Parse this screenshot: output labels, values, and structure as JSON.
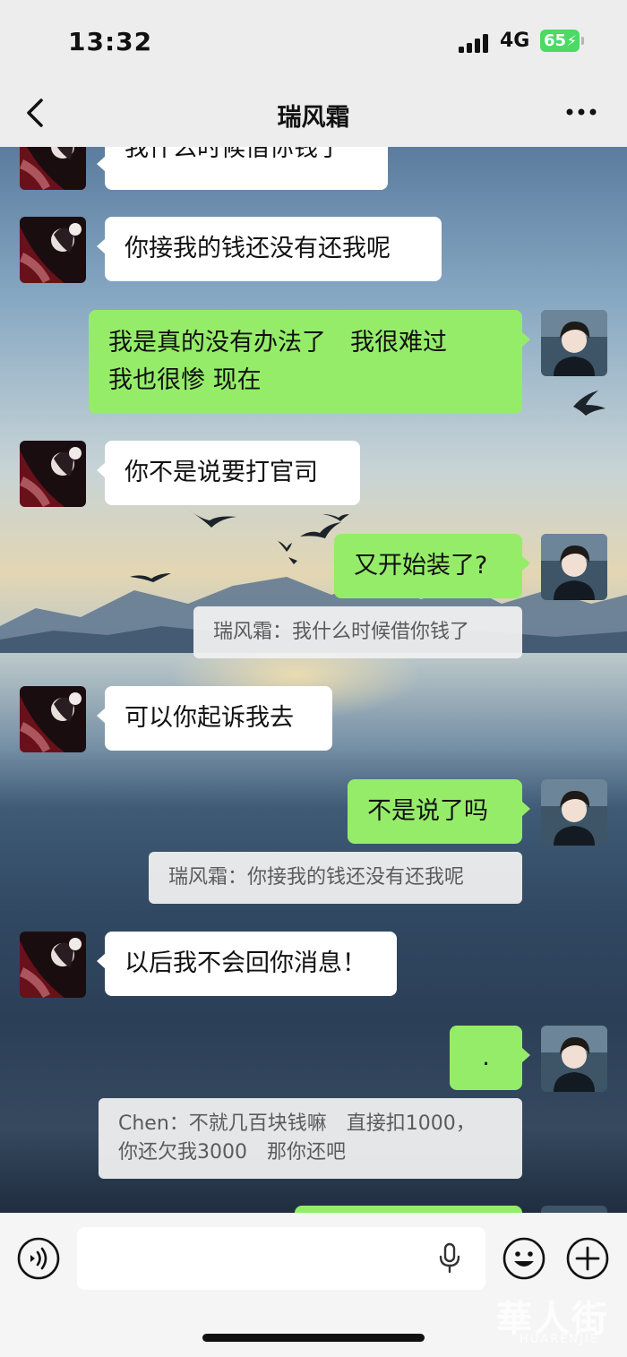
{
  "status": {
    "time": "13:32",
    "network": "4G",
    "battery": "65"
  },
  "header": {
    "title": "瑞风霜",
    "back_icon": "chevron-left-icon",
    "more_icon": "more-dots-icon"
  },
  "messages": [
    {
      "side": "in",
      "text": "我什么时候借你钱了"
    },
    {
      "side": "in",
      "text": "你接我的钱还没有还我呢"
    },
    {
      "side": "out",
      "line1": "我是真的没有办法了　我很难过",
      "line2": "我也很惨 现在"
    },
    {
      "side": "in",
      "text": "你不是说要打官司"
    },
    {
      "side": "out",
      "text": "又开始装了?",
      "quote": "瑞风霜：我什么时候借你钱了"
    },
    {
      "side": "in",
      "text": "可以你起诉我去"
    },
    {
      "side": "out",
      "text": "不是说了吗",
      "quote": "瑞风霜：你接我的钱还没有还我呢"
    },
    {
      "side": "in",
      "text": "以后我不会回你消息！"
    },
    {
      "side": "out",
      "text": ".",
      "quote": "Chen：不就几百块钱嘛　直接扣1000，\n你还欠我3000　那你还吧"
    }
  ],
  "input": {
    "voice_icon": "voice-icon",
    "mic_icon": "microphone-icon",
    "emoji_icon": "emoji-icon",
    "plus_icon": "plus-icon"
  },
  "watermark": {
    "cn": "華人街",
    "en": "HUARENJIE"
  },
  "colors": {
    "sent_bubble": "#95ec69",
    "received_bubble": "#ffffff",
    "battery": "#4cd964"
  }
}
